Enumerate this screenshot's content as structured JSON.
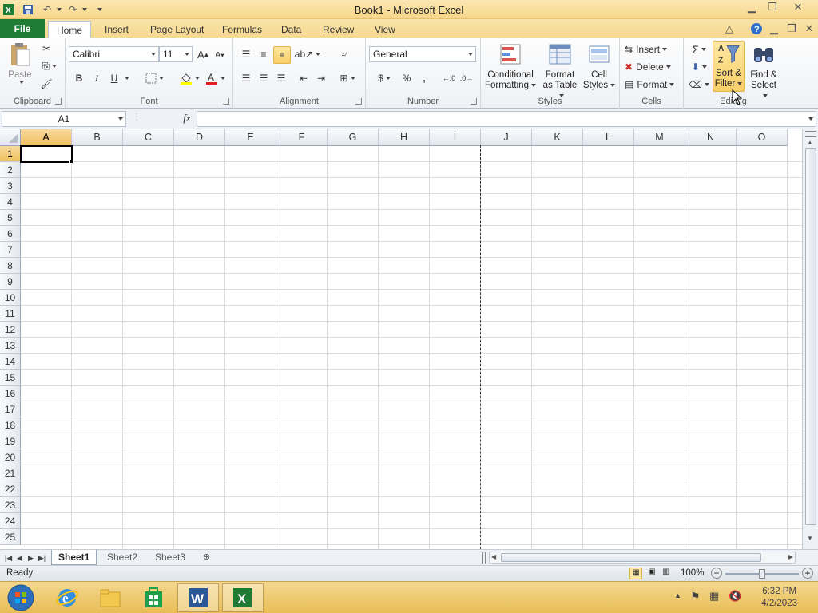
{
  "window": {
    "title": "Book1  -  Microsoft Excel"
  },
  "tabs": [
    "File",
    "Home",
    "Insert",
    "Page Layout",
    "Formulas",
    "Data",
    "Review",
    "View"
  ],
  "ribbon": {
    "clipboard": {
      "paste": "Paste",
      "label": "Clipboard"
    },
    "font": {
      "name": "Calibri",
      "size": "11",
      "bold": "B",
      "italic": "I",
      "underline": "U",
      "label": "Font"
    },
    "alignment": {
      "label": "Alignment"
    },
    "number": {
      "format": "General",
      "currency": "$",
      "percent": "%",
      "comma": ",",
      "label": "Number"
    },
    "styles": {
      "conditional": [
        "Conditional",
        "Formatting"
      ],
      "format_table": [
        "Format",
        "as Table"
      ],
      "cell_styles": [
        "Cell",
        "Styles"
      ],
      "label": "Styles"
    },
    "cells": {
      "insert": "Insert",
      "delete": "Delete",
      "format": "Format",
      "label": "Cells"
    },
    "editing": {
      "sum": "Σ",
      "sort": [
        "Sort &",
        "Filter"
      ],
      "find": [
        "Find &",
        "Select"
      ],
      "label": "Editing"
    }
  },
  "formula_bar": {
    "name_box": "A1",
    "fx": "fx",
    "value": ""
  },
  "grid": {
    "columns": [
      "A",
      "B",
      "C",
      "D",
      "E",
      "F",
      "G",
      "H",
      "I",
      "J",
      "K",
      "L",
      "M",
      "N",
      "O"
    ],
    "rows": [
      "1",
      "2",
      "3",
      "4",
      "5",
      "6",
      "7",
      "8",
      "9",
      "10",
      "11",
      "12",
      "13",
      "14",
      "15",
      "16",
      "17",
      "18",
      "19",
      "20",
      "21",
      "22",
      "23",
      "24",
      "25"
    ],
    "selected_cell": "A1"
  },
  "sheets": [
    "Sheet1",
    "Sheet2",
    "Sheet3"
  ],
  "active_sheet": "Sheet1",
  "status": {
    "text": "Ready",
    "zoom": "100%"
  },
  "taskbar": {
    "time": "6:32 PM",
    "date": "4/2/2023"
  },
  "colors": {
    "file_tab": "#1e7b34",
    "accent": "#f6d68a",
    "selection_header": "#f1c15f"
  }
}
